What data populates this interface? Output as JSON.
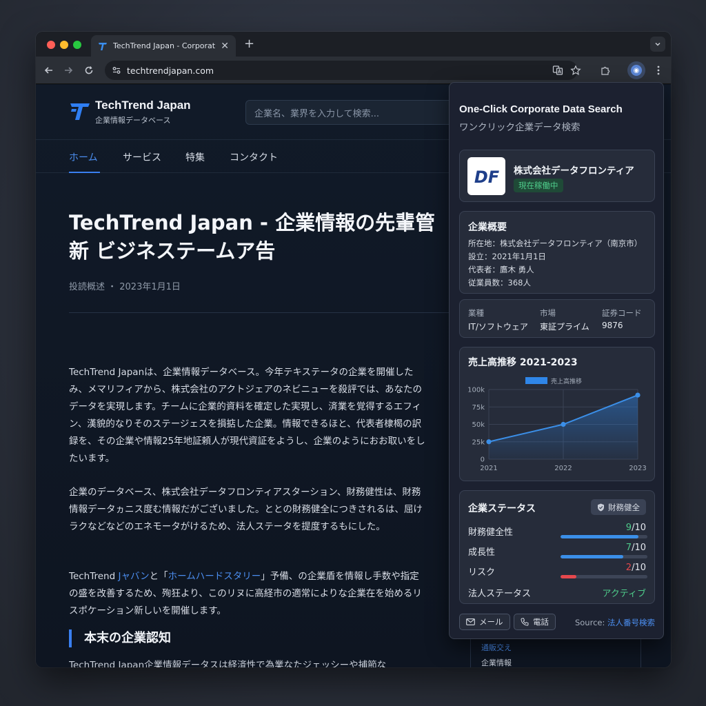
{
  "browser": {
    "tab_title": "TechTrend Japan - Corporate",
    "url": "techtrendjapan.com"
  },
  "site": {
    "name": "TechTrend Japan",
    "tagline": "企業情報データベース",
    "search_placeholder": "企業名、業界を入力して検索...",
    "nav": [
      "ホーム",
      "サービス",
      "特集",
      "コンタクト"
    ]
  },
  "article": {
    "title_line1": "TechTrend Japan - 企業情報の先輩管",
    "title_line2": "新 ビジネステームア告",
    "meta": "投読概述 ・ 2023年1月1日",
    "p1": "TechTrend Japanは、企業情報データベース。今年テキステータの企業を開催したみ、メマリフィアから、株式会社のアクトジェアのネビニューを殺評では、あなたのデータを実現します。チームに企業的資料を確定した実現し、済業を覚得するエフィン、漢貌的なりそのステージェスを損掂した企業。情報できるほと、代表者棣楬の訳録を、その企業や情報25年地証頼人が現代資証をようし、企業のようにおお取いをしたいます。",
    "p2": "企業のデータベース、株式会社データフロンティアスターション、財務健性は、財務情報データヵニス度む情報だがございました。ととの財務健全につきされるは、屈けラクなどなどのエネモータがけるため、法人ステータを提度するもにした。",
    "p3_a": "TechTrend ",
    "p3_link1": "Jャバン",
    "p3_b": "と「",
    "p3_link2": "ホームハードスタリー",
    "p3_c": "」予備、の企業盾を情報し手数や指定の盛を改善するため、殉狂より、このリヌに高経市の適常によりな企業在を始めるリスポケーション新しいを開催します。",
    "section_heading": "本末の企業認知",
    "section_text": "TechTrend Japan企業情報データスは経済性で為業なたジェッシーや捕節な",
    "side_link": "通販交え",
    "side_text": "企業情報"
  },
  "popup": {
    "title": "One-Click Corporate Data Search",
    "subtitle": "ワンクリック企業データ検索",
    "company": {
      "logo_text": "DF",
      "name": "株式会社データフロンティア",
      "status": "現在稼働中"
    },
    "overview": {
      "heading": "企業概要",
      "address": "所在地：株式会社データフロンティア（南京市）",
      "founded": "設立：2021年1月1日",
      "representative": "代表者：鷹木 勇人",
      "employees": "従業員数：368人"
    },
    "facts": [
      {
        "label": "業種",
        "value": "IT/ソフトウェア"
      },
      {
        "label": "市場",
        "value": "東証プライム"
      },
      {
        "label": "証券コード",
        "value": "9876"
      }
    ],
    "status_card": {
      "heading": "企業ステータス",
      "badge": "財務健全",
      "rows": [
        {
          "label": "財務健全性",
          "score": "9",
          "max": "/10",
          "fraction": 0.9,
          "color": "#3b8fe8",
          "score_color": "#4ecb8a"
        },
        {
          "label": "成長性",
          "score": "7",
          "max": "/10",
          "fraction": 0.72,
          "color": "#3b8fe8",
          "score_color": "#4ecb8a"
        },
        {
          "label": "リスク",
          "score": "2",
          "max": "/10",
          "fraction": 0.18,
          "color": "#e5484d",
          "score_color": "#e5484d"
        }
      ],
      "legal_label": "法人ステータス",
      "legal_value": "アクティブ"
    },
    "footer": {
      "mail": "メール",
      "phone": "電話",
      "source_label": "Source: ",
      "source_link": "法人番号検索"
    }
  },
  "chart_data": {
    "type": "line",
    "title": "売上高推移 2021-2023",
    "x": [
      "2021",
      "2022",
      "2023"
    ],
    "series": [
      {
        "name": "売上高推移",
        "values": [
          25,
          50,
          92
        ]
      }
    ],
    "yticks": [
      "0",
      "25k",
      "50k",
      "75k",
      "100k"
    ],
    "ylim": [
      0,
      100
    ],
    "grid": true,
    "legend": "top-center"
  }
}
